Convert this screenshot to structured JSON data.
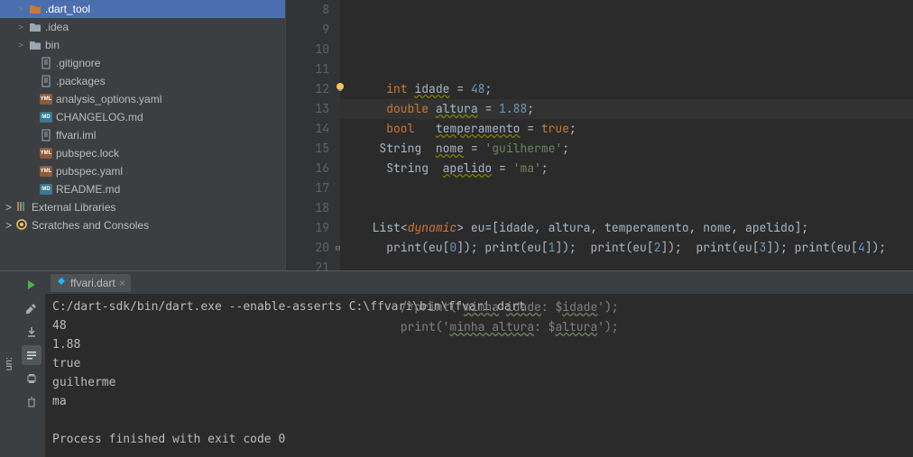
{
  "tree": {
    "items": [
      {
        "indent": 1,
        "arrow": ">",
        "iconType": "folder-open",
        "label": ".dart_tool",
        "selected": true
      },
      {
        "indent": 1,
        "arrow": ">",
        "iconType": "folder",
        "label": ".idea"
      },
      {
        "indent": 1,
        "arrow": ">",
        "iconType": "folder",
        "label": "bin"
      },
      {
        "indent": 2,
        "arrow": "",
        "iconType": "file",
        "label": ".gitignore"
      },
      {
        "indent": 2,
        "arrow": "",
        "iconType": "file",
        "label": ".packages"
      },
      {
        "indent": 2,
        "arrow": "",
        "iconType": "yaml",
        "label": "analysis_options.yaml"
      },
      {
        "indent": 2,
        "arrow": "",
        "iconType": "md",
        "label": "CHANGELOG.md"
      },
      {
        "indent": 2,
        "arrow": "",
        "iconType": "file",
        "label": "ffvari.iml"
      },
      {
        "indent": 2,
        "arrow": "",
        "iconType": "yaml",
        "label": "pubspec.lock"
      },
      {
        "indent": 2,
        "arrow": "",
        "iconType": "yaml",
        "label": "pubspec.yaml"
      },
      {
        "indent": 2,
        "arrow": "",
        "iconType": "md",
        "label": "README.md"
      }
    ],
    "external": "External Libraries",
    "scratches": "Scratches and Consoles"
  },
  "editor": {
    "startLine": 8,
    "lines": [
      {
        "n": 8,
        "html": ""
      },
      {
        "n": 9,
        "html": "    <span class='kw'>int</span> <span class='warn'>idade</span> = <span class='num'>48</span>;"
      },
      {
        "n": 10,
        "html": "    <span class='kw'>double</span> <span class='warn'>altura</span> = <span class='num'>1.88</span>;"
      },
      {
        "n": 11,
        "html": "    <span class='kw'>bool</span>   <span class='warn'>temperamento</span> = <span class='kw'>true</span>;"
      },
      {
        "n": 12,
        "html": "   <span class='type'>String</span>  <span class='warn'>nome</span> = <span class='str'>'guilherme'</span>;"
      },
      {
        "n": 13,
        "html": "    <span class='type'>String</span>  <span class='warn'>apelido</span> = <span class='str'>'ma'</span>;"
      },
      {
        "n": 14,
        "html": ""
      },
      {
        "n": 15,
        "html": ""
      },
      {
        "n": 16,
        "html": "  <span class='type'>List</span>&lt;<span class='generic'>dynamic</span>&gt; eu=[idade, altura, temperamento, nome, apelido];"
      },
      {
        "n": 17,
        "html": "    print(eu[<span class='num'>0</span>]); print(eu[<span class='num'>1</span>]);  print(eu[<span class='num'>2</span>]);  print(eu[<span class='num'>3</span>]); print(eu[<span class='num'>4</span>]);"
      },
      {
        "n": 18,
        "html": ""
      },
      {
        "n": 19,
        "html": ""
      },
      {
        "n": 20,
        "html": "      <span class='cmt'>/*print('<span class='warn' style='text-decoration-color:#6a8759'>mimha</span> <span class='warn' style='text-decoration-color:#6a8759'>idade</span>: $<span class='warn' style='text-decoration-color:#6a8759'>idade</span>');</span>"
      },
      {
        "n": 21,
        "html": "      <span class='cmt'>print('<span class='warn' style='text-decoration-color:#6a8759'>minha altura</span>: $<span class='warn' style='text-decoration-color:#6a8759'>altura</span>');</span>"
      }
    ]
  },
  "run": {
    "leftLabel": "un:",
    "tab": "ffvari.dart",
    "lines": [
      "C:/dart-sdk/bin/dart.exe --enable-asserts C:\\ffvari\\bin\\ffvari.dart",
      "48",
      "1.88",
      "true",
      "guilherme",
      "ma",
      "",
      "Process finished with exit code 0"
    ]
  }
}
